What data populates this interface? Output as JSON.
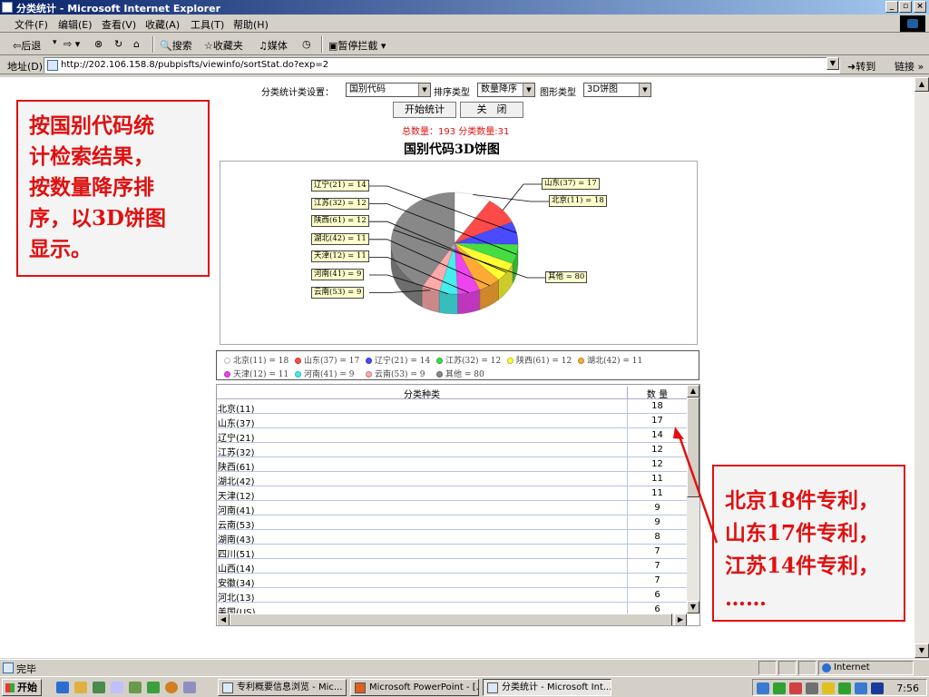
{
  "window": {
    "title": "分类统计 - Microsoft Internet Explorer",
    "min": "_",
    "max": "▫",
    "close": "×"
  },
  "menu": [
    "文件(F)",
    "编辑(E)",
    "查看(V)",
    "收藏(A)",
    "工具(T)",
    "帮助(H)"
  ],
  "toolbar": {
    "back": "⇦后退",
    "search": "搜索",
    "favorites": "收藏夹",
    "media": "媒体",
    "popup": "暂停拦截"
  },
  "address": {
    "label": "地址(D)",
    "url": "http://202.106.158.8/pubpisfts/viewinfo/sortStat.do?exp=2",
    "go": "转到",
    "links": "链接 »"
  },
  "form": {
    "setting_label": "分类统计类设置：",
    "category_value": "国别代码",
    "sort_label": "排序类型",
    "sort_value": "数量降序",
    "chart_type_label": "图形类型",
    "chart_type_value": "3D饼图",
    "start_button": "开始统计",
    "close_button": "关　闭",
    "summary": "总数量：193 分类数量:31"
  },
  "callouts": {
    "left": [
      "按国别代码统",
      "计检索结果，",
      "按数量降序排",
      "序，以3D饼图",
      "显示。"
    ],
    "right": [
      "北京18件专利，",
      "山东17件专利，",
      "江苏14件专利，",
      "……"
    ]
  },
  "chart_data": {
    "type": "pie",
    "title": "国别代码3D饼图",
    "categories": [
      "北京(11)",
      "山东(37)",
      "辽宁(21)",
      "江苏(32)",
      "陕西(61)",
      "湖北(42)",
      "天津(12)",
      "河南(41)",
      "云南(53)",
      "其他"
    ],
    "values": [
      18,
      17,
      14,
      12,
      12,
      11,
      11,
      9,
      9,
      80
    ],
    "colors": [
      "#ffffff",
      "#ff4a4a",
      "#4a4aff",
      "#44dd44",
      "#ffff33",
      "#ffaa33",
      "#ee44ee",
      "#44eeee",
      "#ffaaaa",
      "#888888"
    ],
    "labels": [
      "北京(11) = 18",
      "山东(37) = 17",
      "辽宁(21) = 14",
      "江苏(32) = 12",
      "陕西(61) = 12",
      "湖北(42) = 11",
      "天津(12) = 11",
      "河南(41) = 9",
      "云南(53) = 9",
      "其他 = 80"
    ],
    "legend_position": "bottom"
  },
  "table": {
    "headers": [
      "分类种类",
      "数 量"
    ],
    "rows": [
      [
        "北京(11)",
        "18"
      ],
      [
        "山东(37)",
        "17"
      ],
      [
        "辽宁(21)",
        "14"
      ],
      [
        "江苏(32)",
        "12"
      ],
      [
        "陕西(61)",
        "12"
      ],
      [
        "湖北(42)",
        "11"
      ],
      [
        "天津(12)",
        "11"
      ],
      [
        "河南(41)",
        "9"
      ],
      [
        "云南(53)",
        "9"
      ],
      [
        "湖南(43)",
        "8"
      ],
      [
        "四川(51)",
        "7"
      ],
      [
        "山西(14)",
        "7"
      ],
      [
        "安徽(34)",
        "7"
      ],
      [
        "河北(13)",
        "6"
      ],
      [
        "美国(US)",
        "6"
      ]
    ]
  },
  "status": {
    "text": "完毕",
    "zone": "Internet"
  },
  "taskbar": {
    "start": "开始",
    "tasks": [
      "专利概要信息浏览 - Mic...",
      "Microsoft PowerPoint - [...",
      "分类统计 - Microsoft Int..."
    ],
    "clock": "7:56"
  }
}
